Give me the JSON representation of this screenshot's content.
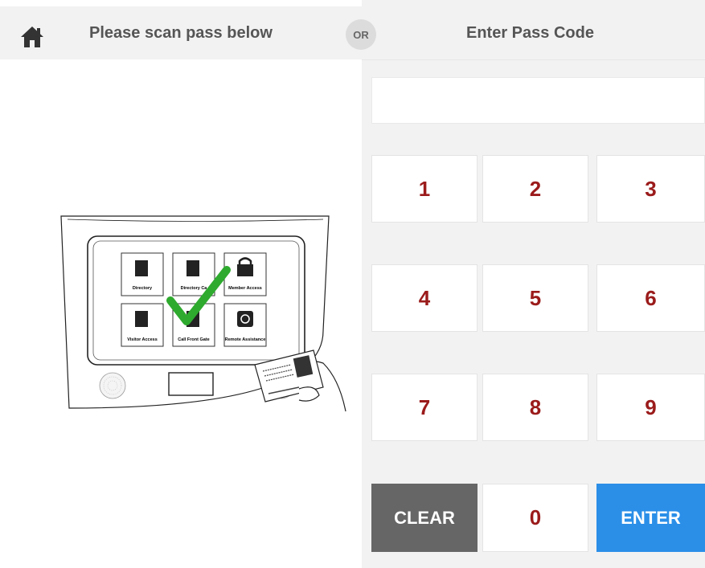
{
  "scan_panel": {
    "title": "Please scan pass below",
    "home_icon": "home-icon",
    "illustration": {
      "tiles": [
        {
          "label": "Directory",
          "icon": "address-book-icon"
        },
        {
          "label": "Directory Ca",
          "icon": "phone-book-icon"
        },
        {
          "label": "Member Access",
          "icon": "lock-icon"
        },
        {
          "label": "Visitor Access",
          "icon": "visitor-card-icon"
        },
        {
          "label": "Call Front Gate",
          "icon": "phone-icon"
        },
        {
          "label": "Remote Assistance",
          "icon": "headset-icon"
        }
      ],
      "check_color": "#2eaa2e"
    }
  },
  "divider": {
    "or_label": "OR"
  },
  "code_panel": {
    "title": "Enter Pass Code",
    "code_value": "",
    "keys": {
      "k1": "1",
      "k2": "2",
      "k3": "3",
      "k4": "4",
      "k5": "5",
      "k6": "6",
      "k7": "7",
      "k8": "8",
      "k9": "9",
      "clear": "CLEAR",
      "k0": "0",
      "enter": "ENTER"
    },
    "colors": {
      "digit": "#9b1b1b",
      "clear_bg": "#666666",
      "enter_bg": "#2b8fe8"
    }
  }
}
